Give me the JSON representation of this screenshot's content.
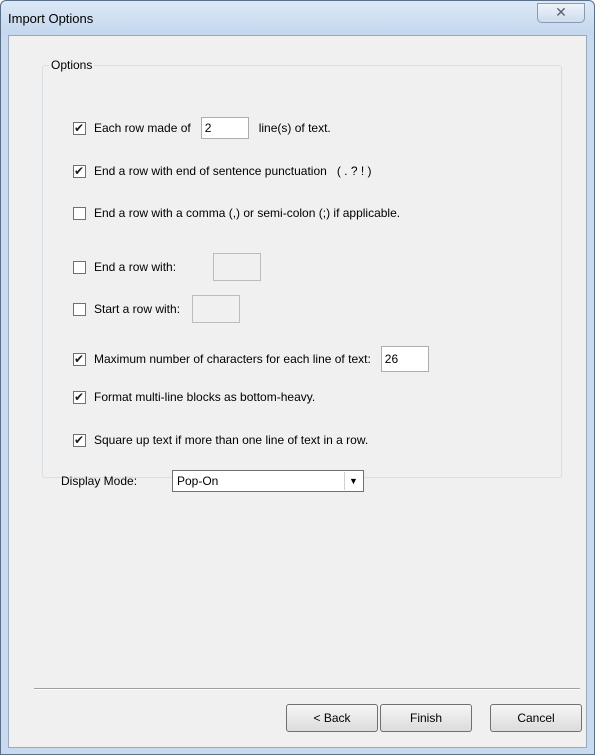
{
  "window": {
    "title": "Import Options",
    "close_glyph": "✕"
  },
  "options": {
    "legend": "Options",
    "rows_per": {
      "label_pre": "Each row made of",
      "value": "2",
      "label_post": "line(s) of text.",
      "checked": true
    },
    "end_sentence": {
      "label": "End a row with end of sentence punctuation   ( . ? ! )",
      "checked": true
    },
    "end_comma": {
      "label": "End a row with a comma (,) or semi-colon (;) if applicable.",
      "checked": false
    },
    "end_with": {
      "label": "End a row with:",
      "value": "",
      "checked": false
    },
    "start_with": {
      "label": "Start a row with:",
      "value": "",
      "checked": false
    },
    "max_chars": {
      "label": "Maximum number of characters for each line of text:",
      "value": "26",
      "checked": true
    },
    "bottom_heavy": {
      "label": "Format multi-line blocks as bottom-heavy.",
      "checked": true
    },
    "square_up": {
      "label": "Square up text if more than one line of text in a row.",
      "checked": true
    },
    "display_mode": {
      "label": "Display Mode:",
      "selected": "Pop-On"
    }
  },
  "buttons": {
    "back": "< Back",
    "finish": "Finish",
    "cancel": "Cancel"
  }
}
